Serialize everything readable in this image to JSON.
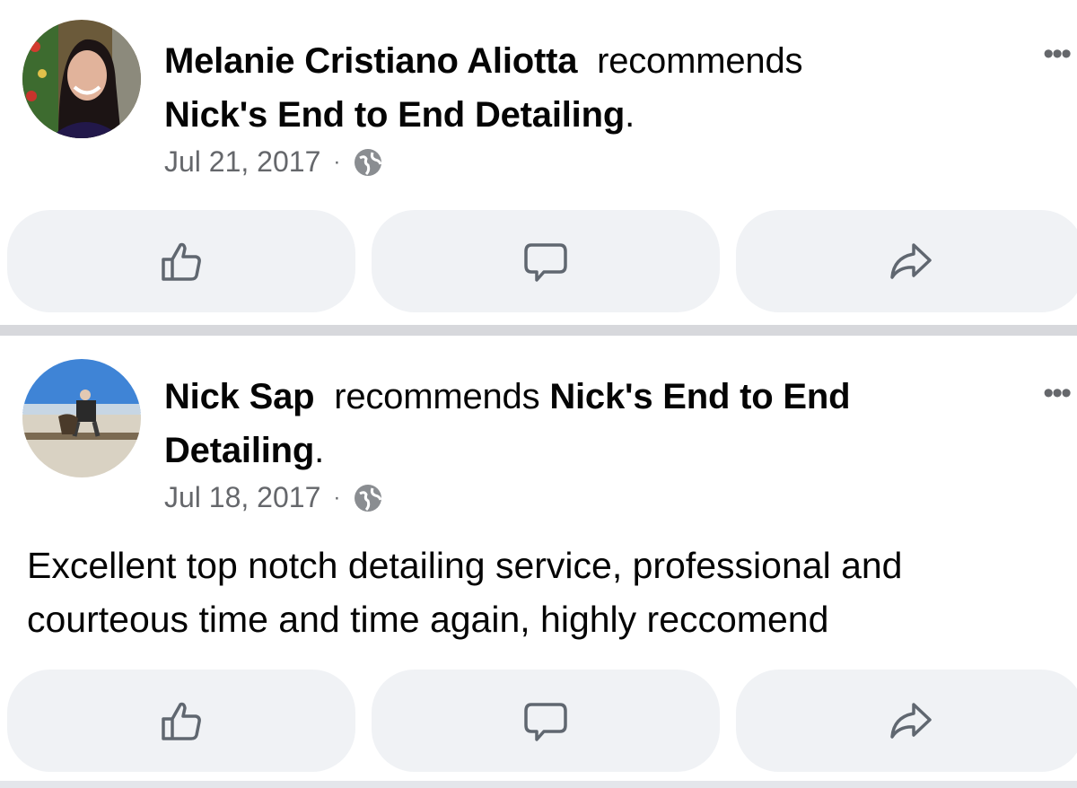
{
  "posts": [
    {
      "author": "Melanie Cristiano Aliotta",
      "verb": "recommends",
      "page": "Nick's End to End Detailing",
      "period": ".",
      "date": "Jul 21, 2017",
      "separator": "·",
      "more": "•••",
      "text": "",
      "actions": [
        "like-icon",
        "comment-icon",
        "share-icon"
      ]
    },
    {
      "author": "Nick Sap",
      "verb": "recommends",
      "page": "Nick's End to End Detailing",
      "period": ".",
      "date": "Jul 18, 2017",
      "separator": "·",
      "more": "•••",
      "text": "Excellent top notch detailing service, professional and courteous time and time again, highly reccomend",
      "actions": [
        "like-icon",
        "comment-icon",
        "share-icon"
      ]
    }
  ],
  "colors": {
    "button_bg": "#f0f2f5",
    "meta_text": "#65676b",
    "divider": "#d7d8dc"
  }
}
